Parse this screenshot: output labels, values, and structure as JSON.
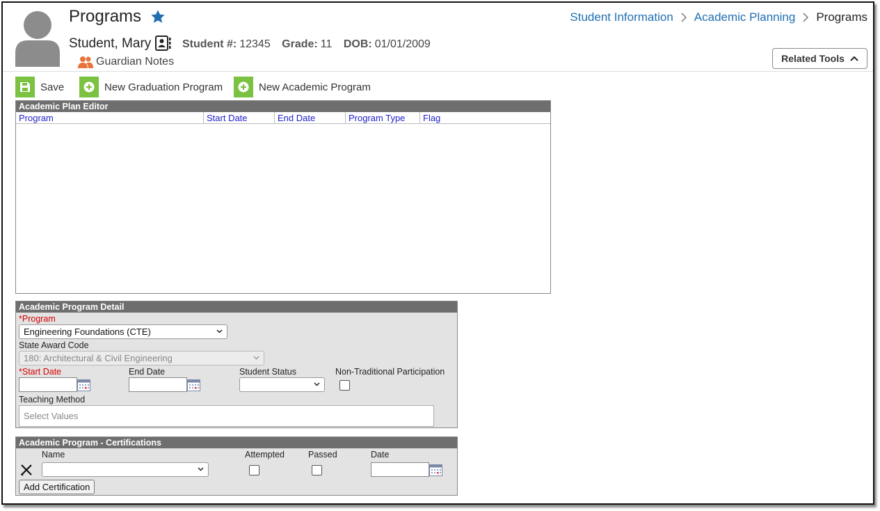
{
  "header": {
    "title": "Programs",
    "breadcrumb": [
      "Student Information",
      "Academic Planning",
      "Programs"
    ],
    "student_name": "Student, Mary",
    "student_number_label": "Student #:",
    "student_number": "12345",
    "grade_label": "Grade:",
    "grade": "11",
    "dob_label": "DOB:",
    "dob": "01/01/2009",
    "guardian_notes": "Guardian Notes",
    "related_tools": "Related Tools"
  },
  "toolbar": {
    "save": "Save",
    "new_graduation": "New Graduation Program",
    "new_academic": "New Academic Program"
  },
  "plan_editor": {
    "title": "Academic Plan Editor",
    "columns": [
      "Program",
      "Start Date",
      "End Date",
      "Program Type",
      "Flag"
    ]
  },
  "program_detail": {
    "title": "Academic Program Detail",
    "program_label": "*Program",
    "program_value": "Engineering Foundations (CTE)",
    "state_award_label": "State Award Code",
    "state_award_value": "180: Architectural & Civil Engineering",
    "start_date_label": "*Start Date",
    "end_date_label": "End Date",
    "student_status_label": "Student Status",
    "non_traditional_label": "Non-Traditional Participation",
    "teaching_method_label": "Teaching Method",
    "teaching_method_placeholder": "Select Values"
  },
  "certifications": {
    "title": "Academic Program - Certifications",
    "name_label": "Name",
    "attempted_label": "Attempted",
    "passed_label": "Passed",
    "date_label": "Date",
    "add_button": "Add Certification"
  },
  "colors": {
    "link": "#1f6fb2",
    "accent_green": "#7cc242",
    "panel_header": "#6e6e6e",
    "required": "#d40000",
    "grid_header_text": "#2222cc",
    "guardian_icon": "#e8743b",
    "star": "#1f6fb2"
  }
}
